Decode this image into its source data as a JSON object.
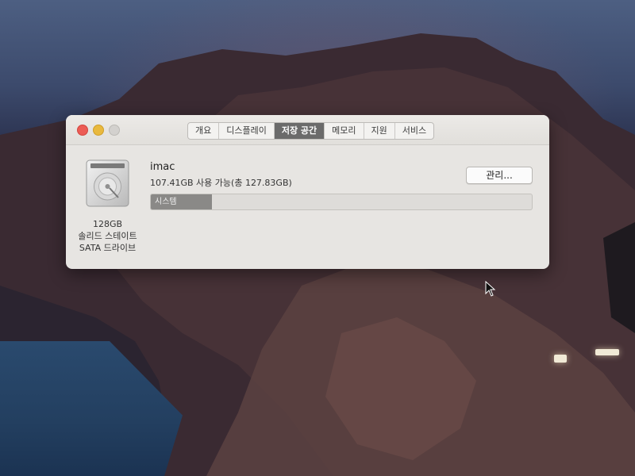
{
  "window": {
    "tabs": [
      {
        "label": "개요",
        "active": false
      },
      {
        "label": "디스플레이",
        "active": false
      },
      {
        "label": "저장 공간",
        "active": true
      },
      {
        "label": "메모리",
        "active": false
      },
      {
        "label": "지원",
        "active": false
      },
      {
        "label": "서비스",
        "active": false
      }
    ]
  },
  "storage": {
    "disk_icon": "hard-drive-icon",
    "disk_size": "128GB",
    "disk_type_line1": "솔리드 스테이트",
    "disk_type_line2": "SATA 드라이브",
    "volume_name": "imac",
    "availability": "107.41GB 사용 가능(총 127.83GB)",
    "manage_label": "관리...",
    "usage_bar": {
      "segment_label": "시스템",
      "used_fraction": 0.16,
      "color": "#8a8987"
    }
  },
  "colors": {
    "close": "#ec5c55",
    "minimize": "#e9b93e",
    "zoom_disabled": "#d3d1ce",
    "active_tab": "#6b6b6b"
  }
}
